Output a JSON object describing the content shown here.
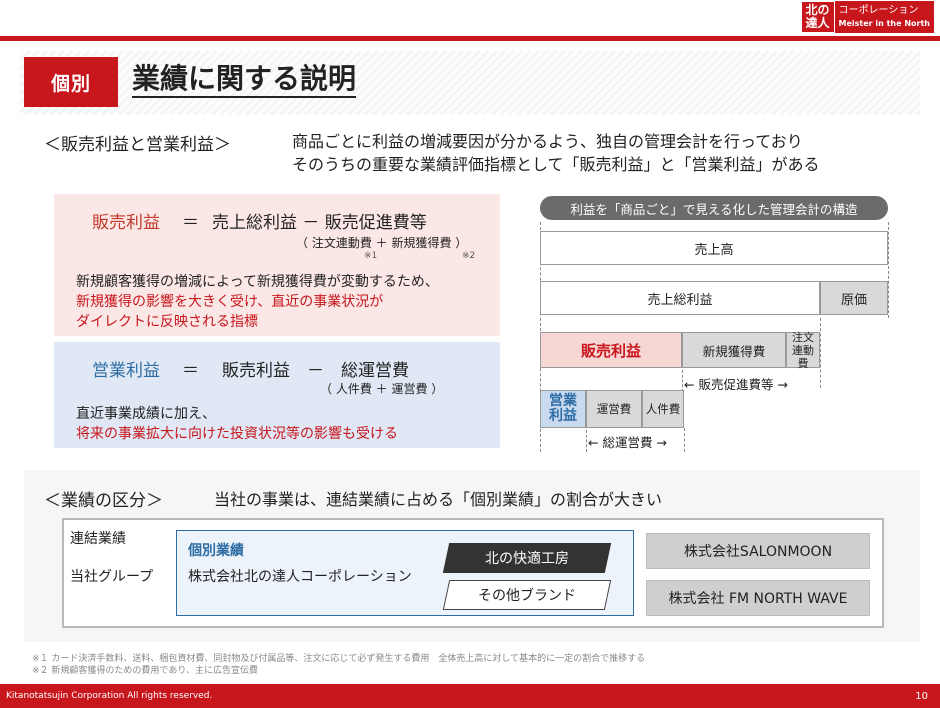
{
  "logo": {
    "mark": "北の\n達人",
    "text_jp": "コーポレーション",
    "text_en": "Meister in the North"
  },
  "header": {
    "tag": "個別",
    "title": "業績に関する説明"
  },
  "section1": {
    "heading": "＜販売利益と営業利益＞",
    "desc_line1": "商品ごとに利益の増減要因が分かるよう、独自の管理会計を行っており",
    "desc_line2": "そのうちの重要な業績評価指標として「販売利益」と「営業利益」がある",
    "formula1": {
      "left": "販売利益",
      "eq": "＝",
      "right": "売上総利益 － 販売促進費等",
      "sub": "（ 注文連動費 ＋ 新規獲得費 ）",
      "mark1": "※1",
      "mark2": "※2",
      "desc_line1": "新規顧客獲得の増減によって新規獲得費が変動するため、",
      "desc_line2": "新規獲得の影響を大きく受け、直近の事業状況が",
      "desc_line3": "ダイレクトに反映される指標"
    },
    "formula2": {
      "left": "営業利益",
      "eq": "＝",
      "right": "販売利益　－　総運営費",
      "sub": "（ 人件費 ＋ 運営費 ）",
      "desc_line1": "直近事業成績に加え、",
      "desc_line2": "将来の事業拡大に向けた投資状況等の影響も受ける"
    }
  },
  "structure": {
    "pill": "利益を「商品ごと」で見える化した管理会計の構造",
    "uriage": "売上高",
    "sori": "売上総利益",
    "genka": "原価",
    "hanbai": "販売利益",
    "shinki": "新規獲得費",
    "chumon": "注文\n連動費",
    "arrow_hanbai": "← 販売促進費等 →",
    "eigyo": "営業\n利益",
    "unei": "運営費",
    "jinken": "人件費",
    "arrow_sou": "← 総運営費 →"
  },
  "section2": {
    "heading": "＜業績の区分＞",
    "desc": "当社の事業は、連結業績に占める「個別業績」の割合が大きい",
    "renketsu": "連結業績",
    "group": "当社グループ",
    "kobetsu_title": "個別業績",
    "kobetsu_company": "株式会社北の達人コーポレーション",
    "brand_main": "北の快適工房",
    "brand_other": "その他ブランド",
    "co_salon": "株式会社SALONMOON",
    "co_fm": "株式会社 FM NORTH WAVE"
  },
  "notes": {
    "note1": "※１ カード決済手数料、送料、梱包資材費、同封物及び付属品等、注文に応じて必ず発生する費用　全体売上高に対して基本的に一定の割合で推移する",
    "note2": "※２ 新規顧客獲得のための費用であり、主に広告宣伝費"
  },
  "footer": {
    "copyright": "Kitanotatsujin Corporation All rights reserved.",
    "page": "10"
  },
  "colors": {
    "brand_red": "#c8161d",
    "profit_red": "#c0392b",
    "profit_blue": "#2e6da4"
  }
}
